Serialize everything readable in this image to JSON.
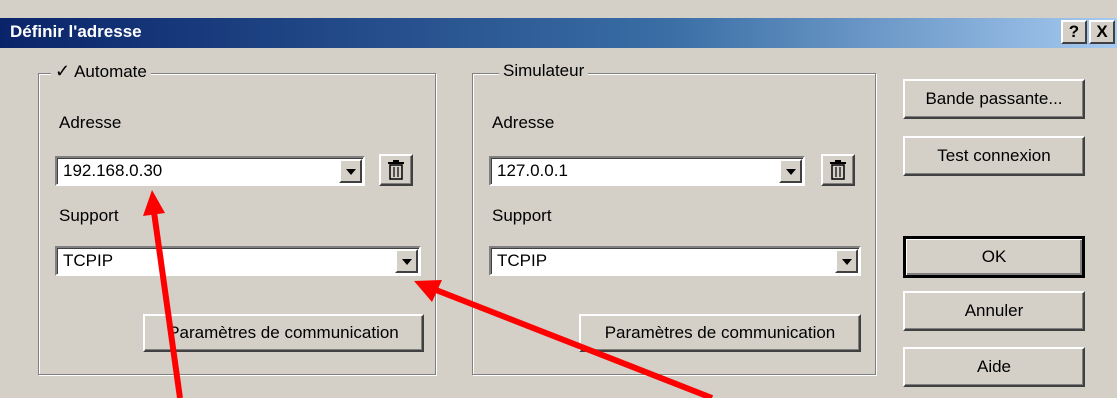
{
  "dialog": {
    "title": "Définir l'adresse",
    "help_label": "?",
    "close_label": "X"
  },
  "automate": {
    "check": "✓",
    "legend": "Automate",
    "address_label": "Adresse",
    "address_value": "192.168.0.30",
    "support_label": "Support",
    "support_value": "TCPIP",
    "comm_button": "Paramètres de communication"
  },
  "simulateur": {
    "legend": "Simulateur",
    "address_label": "Adresse",
    "address_value": "127.0.0.1",
    "support_label": "Support",
    "support_value": "TCPIP",
    "comm_button": "Paramètres de communication"
  },
  "actions": {
    "bandwidth": "Bande passante...",
    "test": "Test connexion",
    "ok": "OK",
    "cancel": "Annuler",
    "help": "Aide"
  },
  "colors": {
    "annotation_arrow": "#ff0000"
  }
}
